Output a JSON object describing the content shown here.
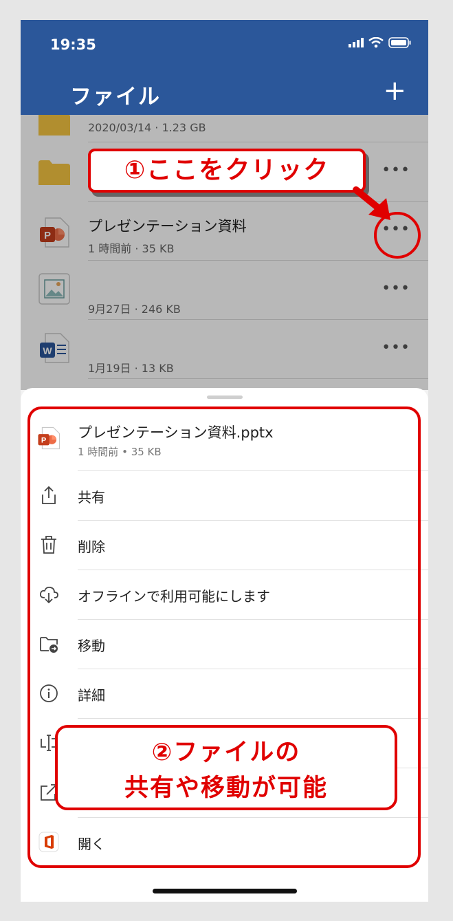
{
  "status_bar": {
    "time": "19:35"
  },
  "header": {
    "title": "ファイル",
    "add_label": "+"
  },
  "files": [
    {
      "name": "",
      "meta": "2020/03/14 · 1.23 GB",
      "icon": "folder-icon",
      "more": "•••"
    },
    {
      "name": "",
      "meta": "",
      "icon": "folder-icon",
      "more": "•••"
    },
    {
      "name": "プレゼンテーション資料",
      "meta": "1 時間前 · 35 KB",
      "icon": "powerpoint-icon",
      "more": "•••"
    },
    {
      "name": "",
      "meta": "9月27日 · 246 KB",
      "icon": "image-icon",
      "more": "•••"
    },
    {
      "name": "",
      "meta": "1月19日 · 13 KB",
      "icon": "word-icon",
      "more": "•••"
    }
  ],
  "sheet": {
    "file_name": "プレゼンテーション資料.pptx",
    "file_meta": "1 時間前 • 35 KB",
    "menu": [
      {
        "label": "共有",
        "icon": "share-icon"
      },
      {
        "label": "削除",
        "icon": "trash-icon"
      },
      {
        "label": "オフラインで利用可能にします",
        "icon": "cloud-download-icon"
      },
      {
        "label": "移動",
        "icon": "move-folder-icon"
      },
      {
        "label": "詳細",
        "icon": "info-icon"
      },
      {
        "label": "",
        "icon": "rename-icon"
      },
      {
        "label": "",
        "icon": "open-external-icon"
      },
      {
        "label": "開く",
        "icon": "office-icon"
      }
    ]
  },
  "annotations": {
    "callout1": "①ここをクリック",
    "callout2_line1": "②ファイルの",
    "callout2_line2": "共有や移動が可能",
    "accent_color": "#e00000"
  },
  "colors": {
    "header": "#2b579a",
    "folder": "#f5c542",
    "powerpoint": "#c43e1c",
    "word": "#2b579a"
  }
}
